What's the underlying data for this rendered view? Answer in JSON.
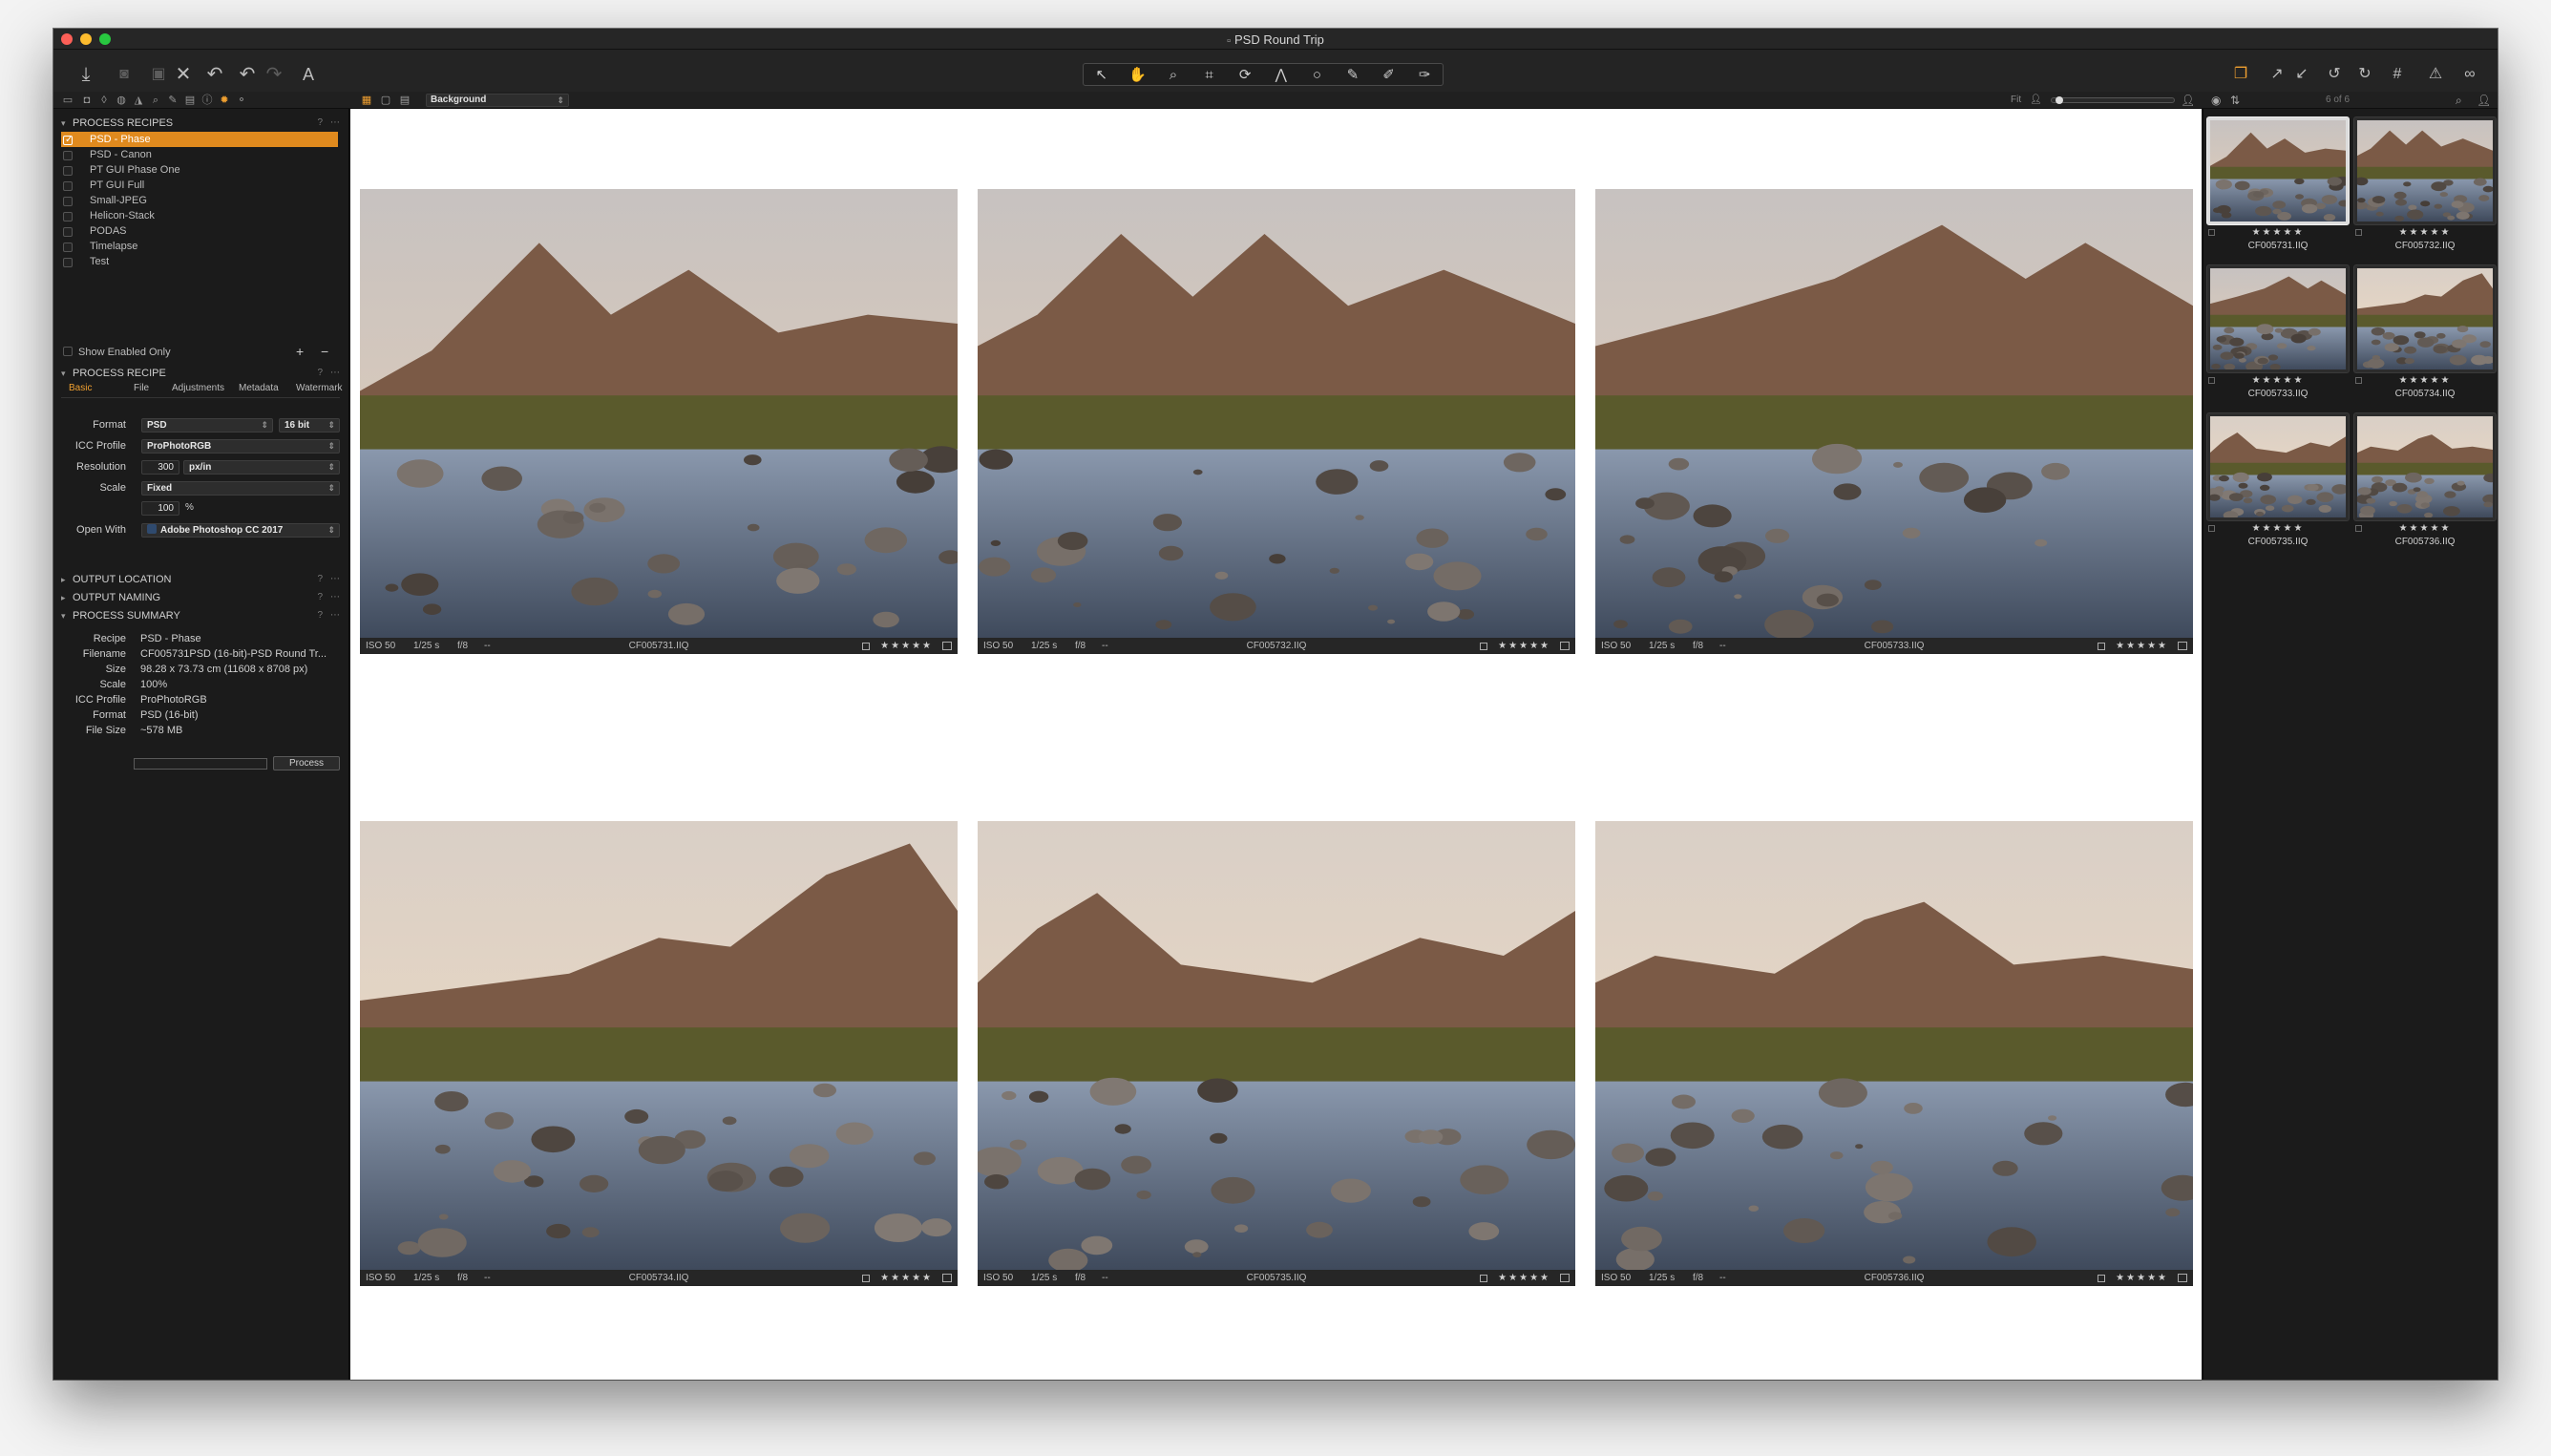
{
  "window": {
    "title": "PSD Round Trip"
  },
  "toolbar": {
    "left_icons": [
      "import-icon",
      "camera-icon",
      "export-icon",
      "delete-icon",
      "undo-history-icon",
      "undo-icon",
      "redo-icon",
      "text-icon"
    ],
    "tools": [
      "cursor-tool-icon",
      "pan-tool-icon",
      "loupe-tool-icon",
      "crop-tool-icon",
      "rotate-tool-icon",
      "keystone-tool-icon",
      "mask-circle-icon",
      "brush-tool-icon",
      "picker-tool-icon",
      "spot-tool-icon"
    ],
    "right_icons": [
      "stack-icon",
      "copy-adjustments-icon",
      "apply-adjustments-icon",
      "rotate-left-icon",
      "rotate-right-icon",
      "grid-icon",
      "warning-icon",
      "glasses-icon"
    ]
  },
  "subbar": {
    "background_select": "Background",
    "fit_label": "Fit",
    "count_label": "6 of 6"
  },
  "colors": {
    "accent": "#f0a030",
    "selection": "#e08a1e",
    "panel": "#1b1b1b",
    "viewer_bg": "#ffffff"
  },
  "recipes": {
    "header": "PROCESS RECIPES",
    "items": [
      {
        "label": "PSD - Phase",
        "selected": true
      },
      {
        "label": "PSD - Canon",
        "selected": false
      },
      {
        "label": "PT GUI Phase One",
        "selected": false
      },
      {
        "label": "PT GUI Full",
        "selected": false
      },
      {
        "label": "Small-JPEG",
        "selected": false
      },
      {
        "label": "Helicon-Stack",
        "selected": false
      },
      {
        "label": "PODAS",
        "selected": false
      },
      {
        "label": "Timelapse",
        "selected": false
      },
      {
        "label": "Test",
        "selected": false
      }
    ],
    "show_enabled_only": "Show Enabled Only"
  },
  "recipe": {
    "header": "PROCESS RECIPE",
    "tabs": [
      "Basic",
      "File",
      "Adjustments",
      "Metadata",
      "Watermark"
    ],
    "format_label": "Format",
    "format": "PSD",
    "bit_depth": "16 bit",
    "icc_label": "ICC Profile",
    "icc": "ProPhotoRGB",
    "resolution_label": "Resolution",
    "resolution": "300",
    "resolution_unit": "px/in",
    "scale_label": "Scale",
    "scale": "Fixed",
    "scale_value": "100",
    "scale_unit": "%",
    "open_with_label": "Open With",
    "open_with": "Adobe Photoshop CC 2017"
  },
  "sections": {
    "output_location": "OUTPUT LOCATION",
    "output_naming": "OUTPUT NAMING",
    "process_summary": "PROCESS SUMMARY"
  },
  "summary": {
    "rows": [
      {
        "k": "Recipe",
        "v": "PSD - Phase"
      },
      {
        "k": "Filename",
        "v": "CF005731PSD (16-bit)-PSD Round Tr..."
      },
      {
        "k": "Size",
        "v": "98.28 x 73.73 cm (11608 x 8708 px)"
      },
      {
        "k": "Scale",
        "v": "100%"
      },
      {
        "k": "ICC Profile",
        "v": "ProPhotoRGB"
      },
      {
        "k": "Format",
        "v": "PSD (16-bit)"
      },
      {
        "k": "File Size",
        "v": "~578 MB"
      }
    ],
    "progress": 0,
    "process_button": "Process"
  },
  "photos": [
    {
      "file": "CF005731.IIQ",
      "iso": "ISO 50",
      "shutter": "1/25 s",
      "aperture": "f/8",
      "extra": "--",
      "rating": "★★★★★"
    },
    {
      "file": "CF005732.IIQ",
      "iso": "ISO 50",
      "shutter": "1/25 s",
      "aperture": "f/8",
      "extra": "--",
      "rating": "★★★★★"
    },
    {
      "file": "CF005733.IIQ",
      "iso": "ISO 50",
      "shutter": "1/25 s",
      "aperture": "f/8",
      "extra": "--",
      "rating": "★★★★★"
    },
    {
      "file": "CF005734.IIQ",
      "iso": "ISO 50",
      "shutter": "1/25 s",
      "aperture": "f/8",
      "extra": "--",
      "rating": "★★★★★"
    },
    {
      "file": "CF005735.IIQ",
      "iso": "ISO 50",
      "shutter": "1/25 s",
      "aperture": "f/8",
      "extra": "--",
      "rating": "★★★★★"
    },
    {
      "file": "CF005736.IIQ",
      "iso": "ISO 50",
      "shutter": "1/25 s",
      "aperture": "f/8",
      "extra": "--",
      "rating": "★★★★★"
    }
  ]
}
